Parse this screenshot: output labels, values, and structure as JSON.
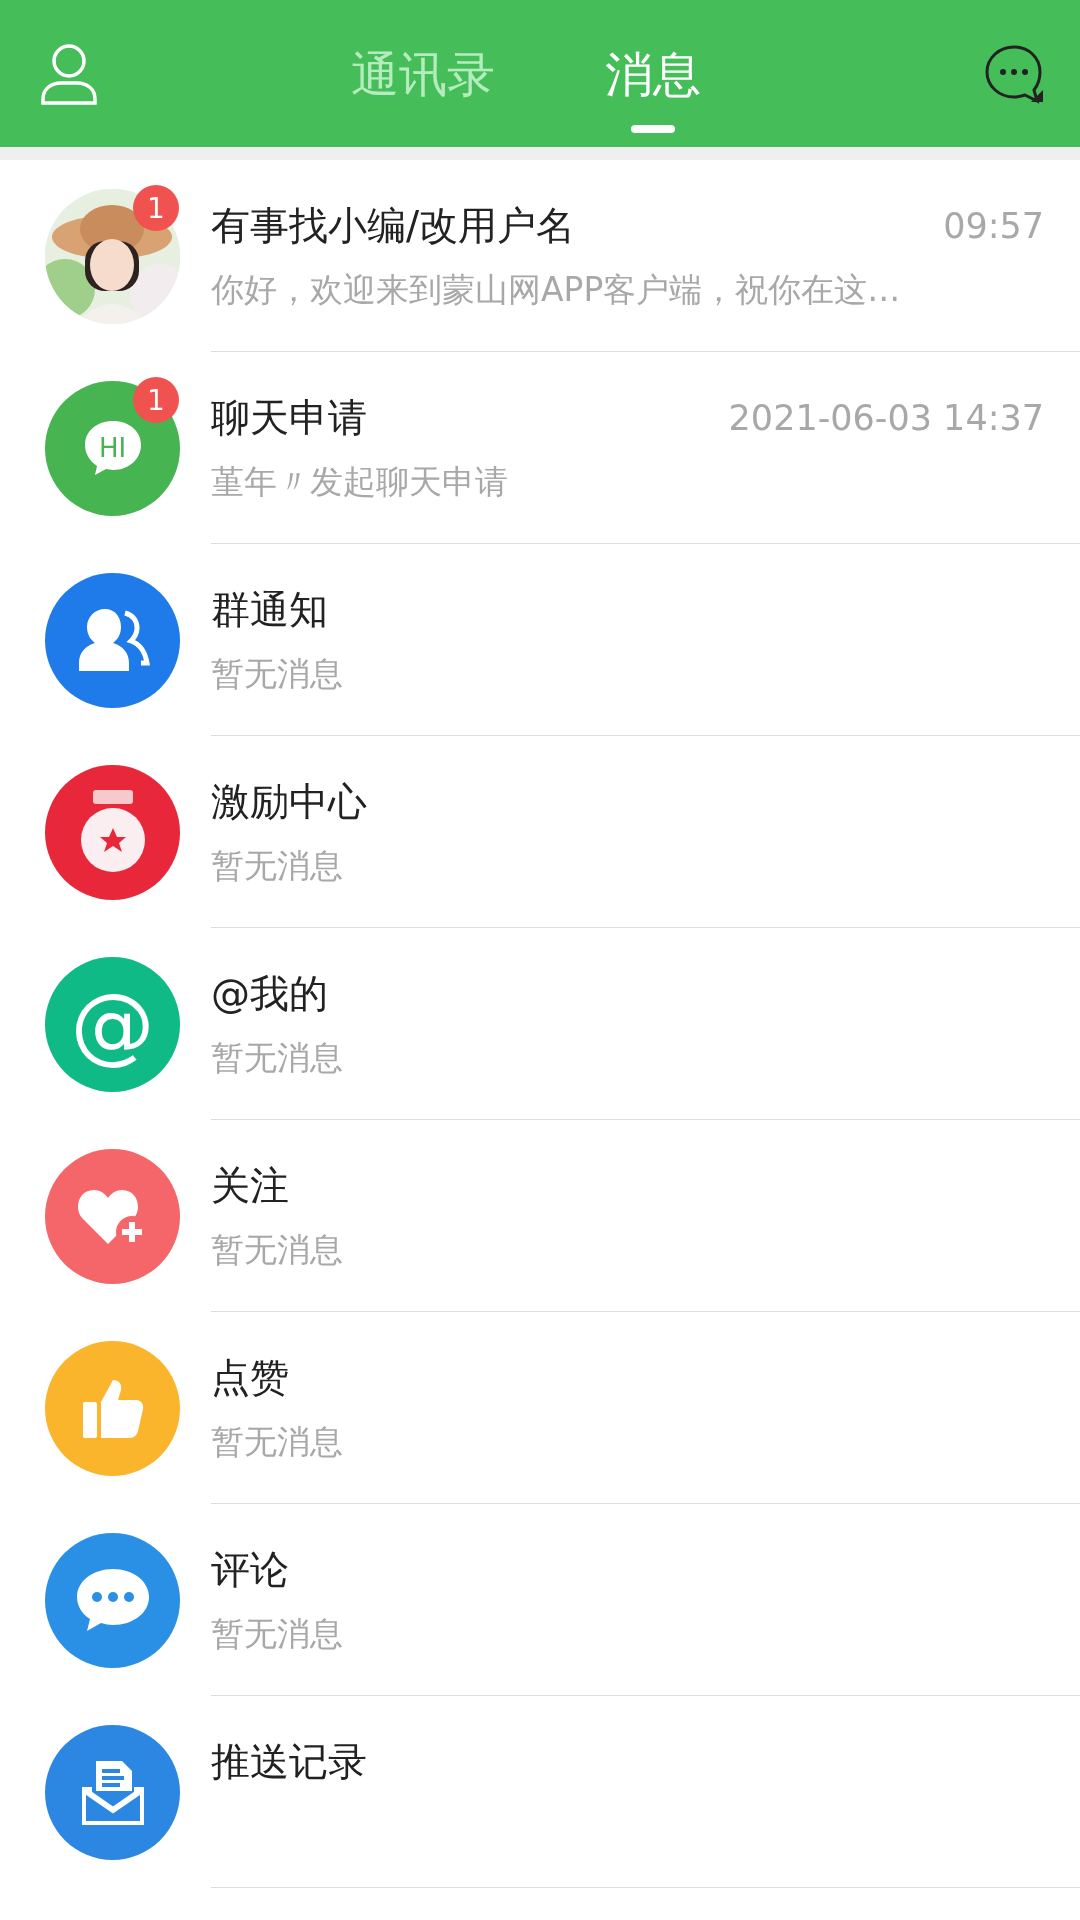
{
  "header": {
    "tabs": [
      {
        "label": "通讯录",
        "selected": false
      },
      {
        "label": "消息",
        "selected": true
      }
    ]
  },
  "conversations": [
    {
      "kind": "picture",
      "title": "有事找小编/改用户名",
      "time": "09:57",
      "preview": "你好，欢迎来到蒙山网APP客户端，祝你在这…",
      "badge": "1"
    },
    {
      "kind": "hi",
      "icon_text": "HI",
      "title": "聊天申请",
      "time": "2021-06-03 14:37",
      "preview": "堇年〃发起聊天申请",
      "badge": "1"
    },
    {
      "kind": "group",
      "title": "群通知",
      "preview": "暂无消息"
    },
    {
      "kind": "medal",
      "title": "激励中心",
      "preview": "暂无消息"
    },
    {
      "kind": "at",
      "icon_text": "@",
      "title": "@我的",
      "preview": "暂无消息"
    },
    {
      "kind": "heart",
      "title": "关注",
      "preview": "暂无消息"
    },
    {
      "kind": "like",
      "title": "点赞",
      "preview": "暂无消息"
    },
    {
      "kind": "comment",
      "title": "评论",
      "preview": "暂无消息"
    },
    {
      "kind": "mail",
      "title": "推送记录"
    }
  ]
}
